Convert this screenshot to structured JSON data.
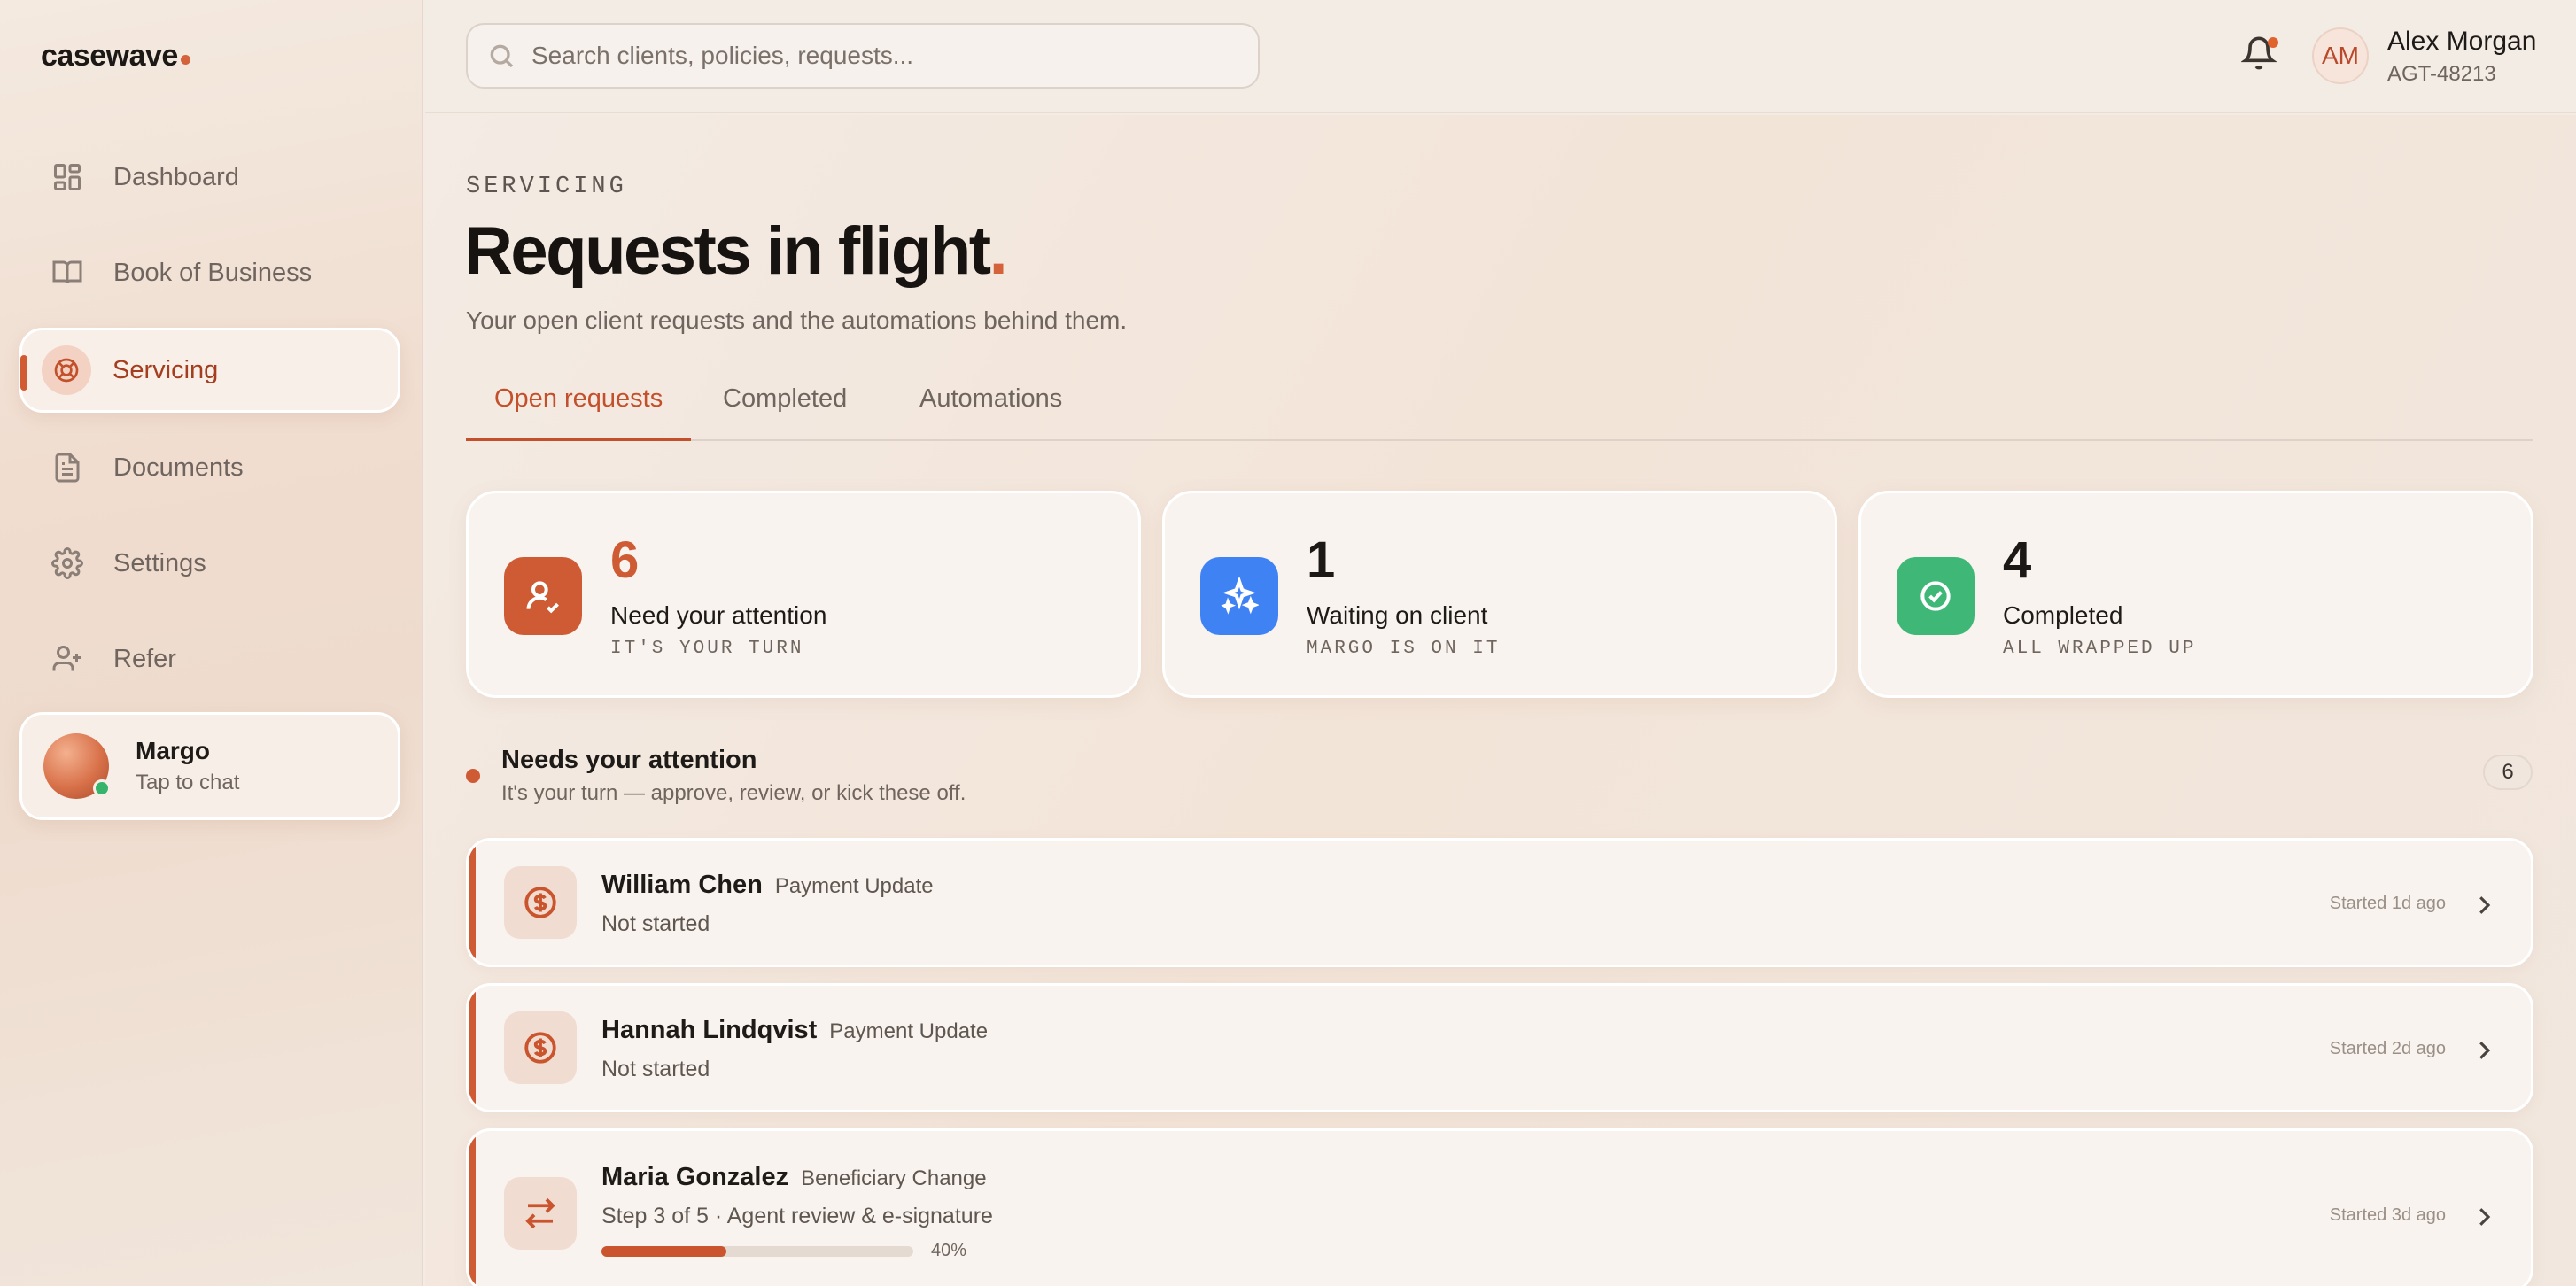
{
  "app": {
    "logo": "casewave"
  },
  "sidebar": {
    "items": [
      {
        "label": "Dashboard",
        "icon": "grid-icon"
      },
      {
        "label": "Book of Business",
        "icon": "book-icon"
      },
      {
        "label": "Servicing",
        "icon": "lifebuoy-icon",
        "active": true
      },
      {
        "label": "Documents",
        "icon": "document-icon"
      },
      {
        "label": "Settings",
        "icon": "gear-icon"
      },
      {
        "label": "Refer",
        "icon": "user-plus-icon"
      }
    ],
    "assistant": {
      "name": "Margo",
      "subtitle": "Tap to chat",
      "status": "online"
    }
  },
  "header": {
    "search_placeholder": "Search clients, policies, requests...",
    "notifications": {
      "icon": "bell-icon",
      "has_unread": true
    },
    "user": {
      "initials": "AM",
      "name": "Alex Morgan",
      "id": "AGT-48213"
    }
  },
  "page": {
    "eyebrow": "SERVICING",
    "title": "Requests in flight",
    "title_dot": ".",
    "subtitle": "Your open client requests and the automations behind them.",
    "tabs": [
      {
        "label": "Open requests",
        "active": true
      },
      {
        "label": "Completed"
      },
      {
        "label": "Automations"
      }
    ]
  },
  "stats": [
    {
      "count": "6",
      "label": "Need your attention",
      "sub": "IT'S YOUR TURN",
      "color": "#cf5b34",
      "icon": "user-check-icon"
    },
    {
      "count": "1",
      "label": "Waiting on client",
      "sub": "MARGO IS ON IT",
      "color": "#3f82f4",
      "icon": "sparkles-icon"
    },
    {
      "count": "4",
      "label": "Completed",
      "sub": "ALL WRAPPED UP",
      "color": "#3fb877",
      "icon": "check-circle-icon"
    }
  ],
  "section": {
    "title": "Needs your attention",
    "subtitle": "It's your turn — approve, review, or kick these off.",
    "count": "6"
  },
  "requests": [
    {
      "name": "William Chen",
      "type": "Payment Update",
      "status": "Not started",
      "started": "Started 1d ago",
      "icon": "dollar-circle-icon"
    },
    {
      "name": "Hannah Lindqvist",
      "type": "Payment Update",
      "status": "Not started",
      "started": "Started 2d ago",
      "icon": "dollar-circle-icon"
    },
    {
      "name": "Maria Gonzalez",
      "type": "Beneficiary Change",
      "status": "Step 3 of 5 · Agent review & e-signature",
      "started": "Started 3d ago",
      "icon": "swap-arrows-icon",
      "progress": 40,
      "progress_label": "40%"
    }
  ]
}
